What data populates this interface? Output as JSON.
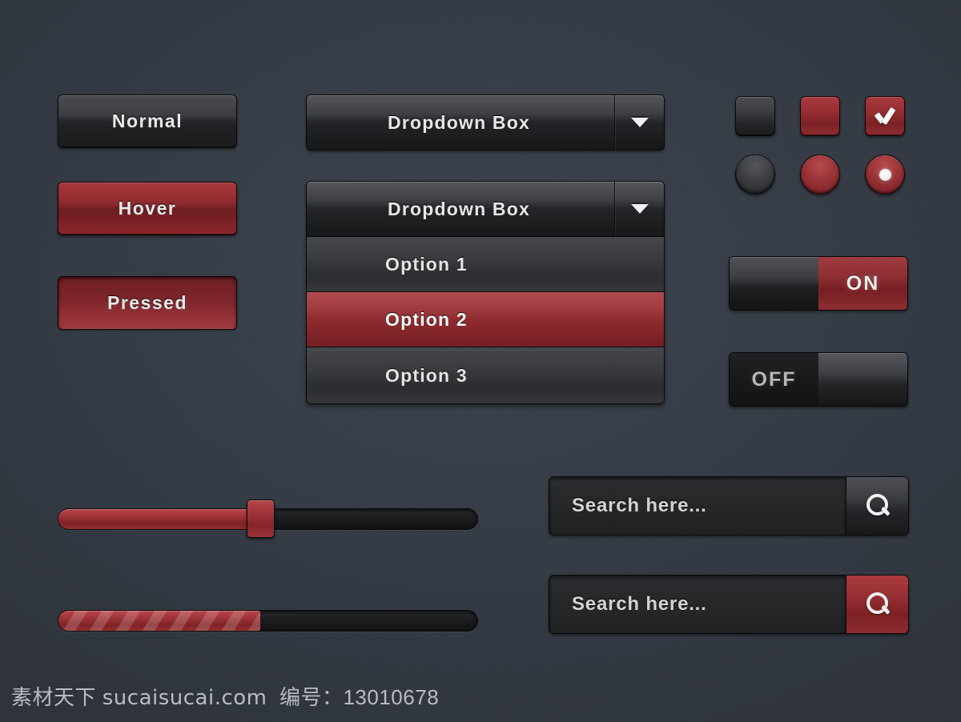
{
  "theme": {
    "background": "#353b44",
    "accent_red": "#8d2a2e",
    "accent_red_light": "#a93a3e",
    "dark_gray": "#3c3e42",
    "text_light": "#e9e9ea"
  },
  "buttons": [
    {
      "label": "Normal",
      "state": "normal",
      "name": "button-normal"
    },
    {
      "label": "Hover",
      "state": "hover",
      "name": "button-hover"
    },
    {
      "label": "Pressed",
      "state": "pressed",
      "name": "button-pressed"
    }
  ],
  "dropdowns": {
    "closed": {
      "label": "Dropdown Box",
      "arrow_icon": "chevron-down-icon",
      "expanded": false
    },
    "open": {
      "label": "Dropdown Box",
      "arrow_icon": "chevron-down-icon",
      "expanded": true,
      "options": [
        {
          "label": "Option 1",
          "selected": false
        },
        {
          "label": "Option 2",
          "selected": true
        },
        {
          "label": "Option 3",
          "selected": false
        }
      ]
    }
  },
  "checkboxes": [
    {
      "state": "normal",
      "checked": false,
      "color": "dark"
    },
    {
      "state": "hover",
      "checked": false,
      "color": "red"
    },
    {
      "state": "checked",
      "checked": true,
      "color": "red",
      "icon": "check-icon"
    }
  ],
  "radios": [
    {
      "state": "normal",
      "selected": false,
      "color": "dark"
    },
    {
      "state": "hover",
      "selected": false,
      "color": "red"
    },
    {
      "state": "selected",
      "selected": true,
      "color": "red",
      "icon": "radio-dot-icon"
    }
  ],
  "toggles": [
    {
      "label": "ON",
      "value": "on",
      "knob_side": "left",
      "name": "toggle-on"
    },
    {
      "label": "OFF",
      "value": "off",
      "knob_side": "right",
      "name": "toggle-off"
    }
  ],
  "slider": {
    "value_percent": 48,
    "min": 0,
    "max": 100,
    "handle": "slider-handle"
  },
  "progress": {
    "value_percent": 48,
    "min": 0,
    "max": 100,
    "style": "striped"
  },
  "search_boxes": [
    {
      "placeholder": "Search here...",
      "value": "",
      "button_style": "gray",
      "button_icon": "search-icon"
    },
    {
      "placeholder": "Search here...",
      "value": "",
      "button_style": "red",
      "button_icon": "search-icon"
    }
  ],
  "watermark": {
    "brand": "素材天下",
    "site": "sucaisucai.com",
    "id_label": "编号：",
    "id_value": "13010678",
    "full": "素材天下 sucaisucai.com  编号： 13010678"
  }
}
